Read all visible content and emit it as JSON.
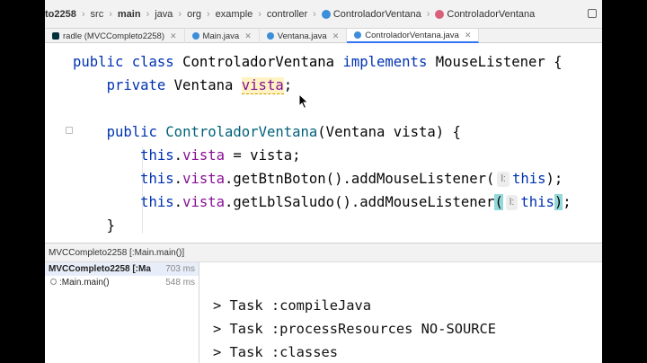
{
  "breadcrumb": {
    "items": [
      "to2258",
      "src",
      "main",
      "java",
      "org",
      "example",
      "controller"
    ],
    "class_crumbs": [
      "ControladorVentana",
      "ControladorVentana"
    ]
  },
  "tabs": [
    {
      "label": "radle (MVCCompleto2258)",
      "icon": "gradle-icon"
    },
    {
      "label": "Main.java",
      "icon": "class-icon"
    },
    {
      "label": "Ventana.java",
      "icon": "class-icon"
    },
    {
      "label": "ControladorVentana.java",
      "icon": "class-icon",
      "active": true
    }
  ],
  "code": {
    "line1": {
      "kw1": "public class",
      "name": "ControladorVentana",
      "kw2": "implements",
      "iface": "MouseListener {"
    },
    "line2": {
      "kw": "private",
      "type": "Ventana",
      "field": "vista",
      "end": ";"
    },
    "line3": {
      "kw": "public",
      "name": "ControladorVentana",
      "params": "(Ventana vista) {"
    },
    "line4": {
      "kw": "this",
      "dot": ".",
      "field": "vista",
      "rest": " = vista;"
    },
    "line5": {
      "kw": "this",
      "dot": ".",
      "field": "vista",
      "call": ".getBtnBoton().addMouseListener(",
      "hint": "l:",
      "arg": "this",
      "end": ");"
    },
    "line6": {
      "kw": "this",
      "dot": ".",
      "field": "vista",
      "call": ".getLblSaludo().addMouseListener",
      "open": "(",
      "hint": "l:",
      "arg": "this",
      "close": ")",
      "end": ";"
    },
    "line7": {
      "brace": "}"
    }
  },
  "run": {
    "header": "MVCCompleto2258 [:Main.main()]",
    "tree": [
      {
        "label": "MVCCompleto2258 [:Ma",
        "time": "703 ms"
      },
      {
        "label": ":Main.main()",
        "time": "548 ms"
      }
    ],
    "console": [
      "> Task :compileJava",
      "> Task :processResources NO-SOURCE",
      "> Task :classes"
    ]
  },
  "colors": {
    "keyword": "#0033b3",
    "field": "#871094",
    "declaration": "#00627a",
    "accent": "#3574f0"
  }
}
